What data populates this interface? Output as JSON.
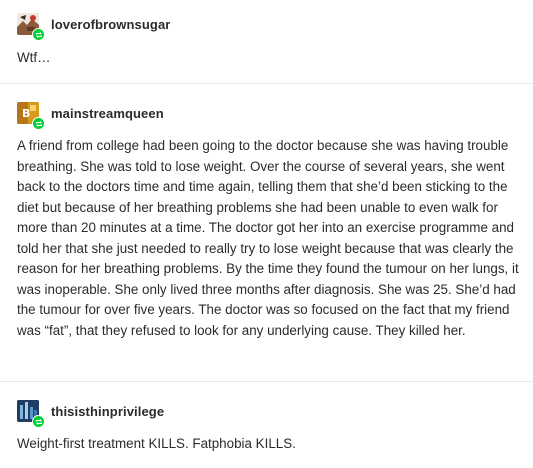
{
  "posts": [
    {
      "username": "loverofbrownsugar",
      "text": "Wtf…"
    },
    {
      "username": "mainstreamqueen",
      "text": "A friend from college had been going to the doctor because she was having trouble breathing. She was told to lose weight. Over the course of several years, she went back to the doctors time and time again, telling them that she’d been sticking to the diet but because of her breathing problems she had been unable to even walk for more than 20 minutes at a time. The doctor got her into an exercise programme and told her that she just needed to really try to lose weight because that was clearly the reason for her breathing problems. By the time they found the tumour on her lungs, it was inoperable. She only lived three months after diagnosis. She was 25. She’d had the tumour for over five years. The doctor was so focused on the fact that my friend was “fat”, that they refused to look for any underlying cause. They killed her."
    },
    {
      "username": "thisisthinprivilege",
      "text": "Weight-first treatment KILLS. Fatphobia KILLS."
    }
  ],
  "colors": {
    "text": "#2b2b2b",
    "reblog_badge": "#00cf35",
    "divider": "#e8e8e8"
  },
  "icons": {
    "reblog": "reblog-icon"
  }
}
